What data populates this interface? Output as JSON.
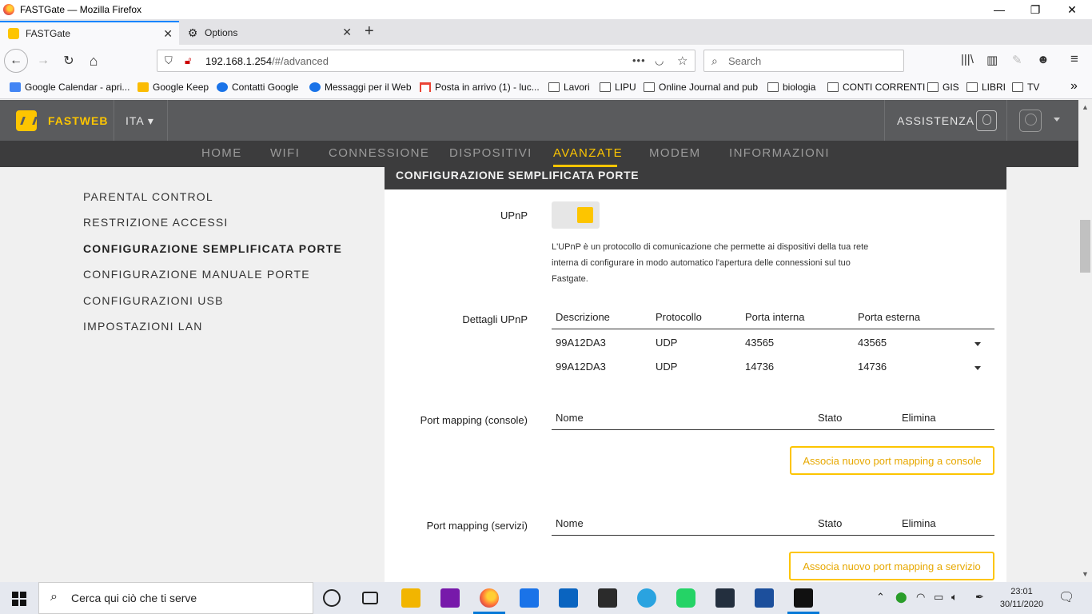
{
  "window": {
    "title": "FASTGate — Mozilla Firefox",
    "min": "—",
    "restore": "❐",
    "close": "✕"
  },
  "tabs": [
    {
      "title": "FASTGate",
      "close": "✕"
    },
    {
      "title": "Options",
      "close": "✕"
    }
  ],
  "new_tab": "+",
  "nav": {
    "back": "←",
    "forward": "→",
    "reload": "↻",
    "home": "⌂",
    "url_host": "192.168.1.254",
    "url_path": "/#/advanced",
    "page_actions": "•••",
    "search_placeholder": "Search"
  },
  "bookmarks": [
    "Google Calendar - apri...",
    "Google Keep",
    "Contatti Google",
    "Messaggi per il Web",
    "Posta in arrivo (1) - luc...",
    "Lavori",
    "LIPU",
    "Online Journal and pub",
    "biologia",
    "CONTI CORRENTI",
    "GIS",
    "LIBRI",
    "TV"
  ],
  "bookmarks_overflow": "»",
  "fastweb": {
    "brand": "FASTWEB",
    "lang": "ITA ▾",
    "assist": "ASSISTENZA",
    "menu": [
      "HOME",
      "WIFI",
      "CONNESSIONE",
      "DISPOSITIVI",
      "AVANZATE",
      "MODEM",
      "INFORMAZIONI"
    ],
    "active_menu": "AVANZATE",
    "accent": "#fdc500"
  },
  "sidebar": [
    "PARENTAL CONTROL",
    "RESTRIZIONE ACCESSI",
    "CONFIGURAZIONE SEMPLIFICATA PORTE",
    "CONFIGURAZIONE MANUALE PORTE",
    "CONFIGURAZIONI USB",
    "IMPOSTAZIONI LAN"
  ],
  "panel": {
    "title": "CONFIGURAZIONE SEMPLIFICATA PORTE",
    "upnp_label": "UPnP",
    "upnp_enabled": true,
    "upnp_desc": "L'UPnP è un protocollo di comunicazione che permette ai dispositivi della tua rete interna di configurare in modo automatico l'apertura delle connessioni sul tuo Fastgate.",
    "details_label": "Dettagli UPnP",
    "details_headers": [
      "Descrizione",
      "Protocollo",
      "Porta interna",
      "Porta esterna"
    ],
    "details_rows": [
      [
        "99A12DA3",
        "UDP",
        "43565",
        "43565"
      ],
      [
        "99A12DA3",
        "UDP",
        "14736",
        "14736"
      ]
    ],
    "console_label": "Port mapping (console)",
    "console_headers": [
      "Nome",
      "Stato",
      "Elimina"
    ],
    "console_button": "Associa nuovo port mapping a console",
    "services_label": "Port mapping (servizi)",
    "services_headers": [
      "Nome",
      "Stato",
      "Elimina"
    ],
    "services_button": "Associa nuovo port mapping a servizio"
  },
  "taskbar": {
    "search_placeholder": "Cerca qui ciò che ti serve",
    "time": "23:01",
    "date": "30/11/2020",
    "apps": [
      "cortana",
      "task-view",
      "file-explorer",
      "onenote",
      "firefox",
      "calendar",
      "outlook",
      "store",
      "telegram",
      "whatsapp",
      "amazon-music",
      "mail-app",
      "terminal"
    ]
  }
}
